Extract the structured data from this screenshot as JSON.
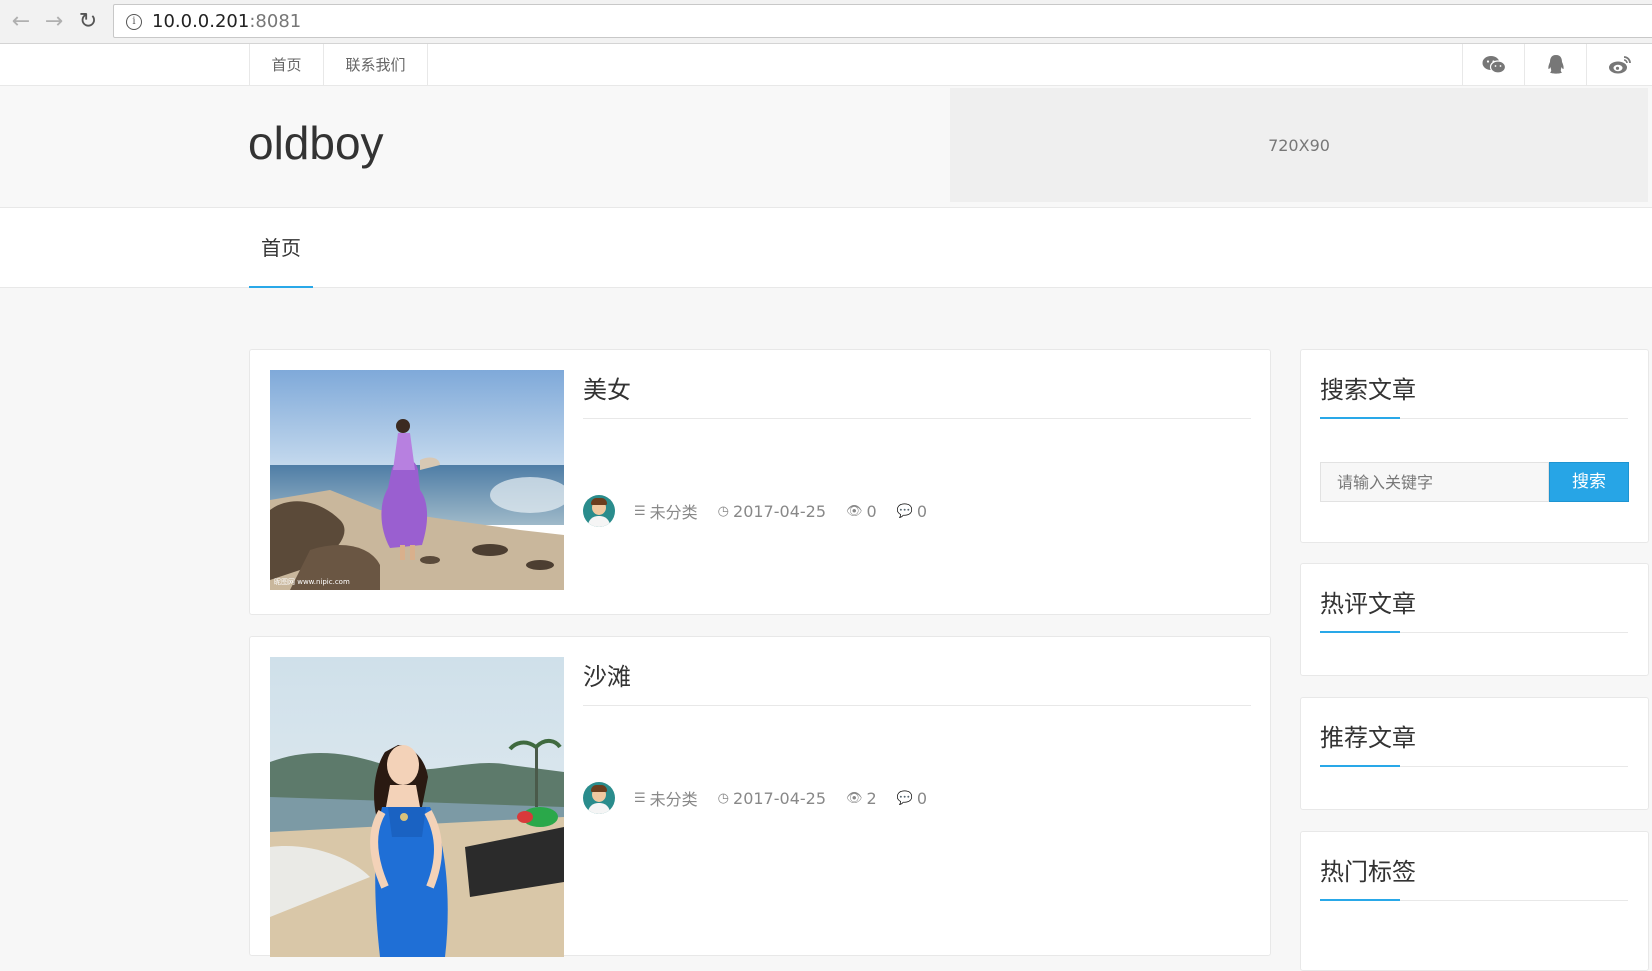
{
  "browser": {
    "host": "10.0.0.201",
    "port": ":8081"
  },
  "topnav": {
    "links": [
      "首页",
      "联系我们"
    ]
  },
  "header": {
    "logo": "oldboy",
    "ad_label": "720X90"
  },
  "mainnav": {
    "items": [
      "首页"
    ]
  },
  "posts": [
    {
      "title": "美女",
      "category": "未分类",
      "date": "2017-04-25",
      "views": "0",
      "comments": "0"
    },
    {
      "title": "沙滩",
      "category": "未分类",
      "date": "2017-04-25",
      "views": "2",
      "comments": "0"
    }
  ],
  "sidebar": {
    "search_title": "搜索文章",
    "search_placeholder": "请输入关键字",
    "search_button": "搜索",
    "hot_comments_title": "热评文章",
    "recommended_title": "推荐文章",
    "hot_tags_title": "热门标签"
  },
  "colors": {
    "accent": "#29a8e8",
    "button": "#27a5e6"
  }
}
